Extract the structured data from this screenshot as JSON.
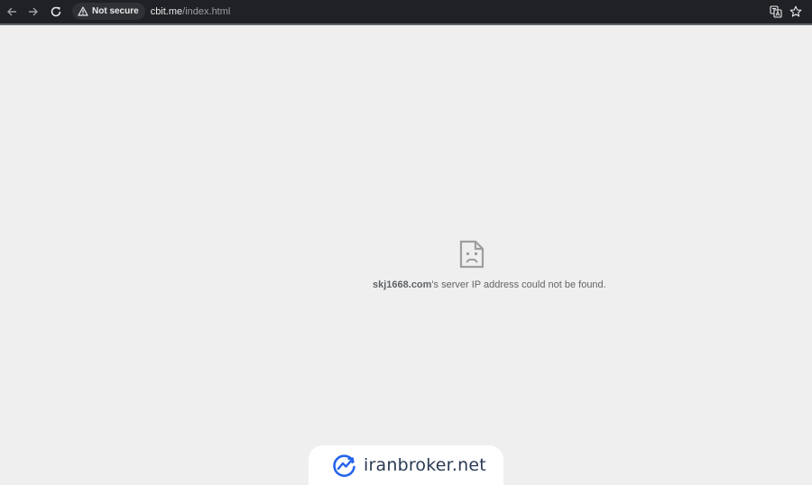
{
  "browser": {
    "security_label": "Not secure",
    "url_host": "cbit.me",
    "url_path": "/index.html",
    "icons": {
      "back": "arrow-left-icon",
      "forward": "arrow-right-icon",
      "reload": "reload-icon",
      "warning": "warning-triangle-icon",
      "translate": "translate-icon",
      "bookmark": "star-icon"
    }
  },
  "error": {
    "host": "skj1668.com",
    "message": "'s server IP address could not be found.",
    "icon": "sad-page-icon"
  },
  "watermark": {
    "text": "iranbroker.net",
    "logo": "iranbroker-logo-icon"
  },
  "colors": {
    "toolbar": "#202124",
    "page_background": "#efefef",
    "error_text": "#646464",
    "watermark_accent": "#2563eb"
  }
}
